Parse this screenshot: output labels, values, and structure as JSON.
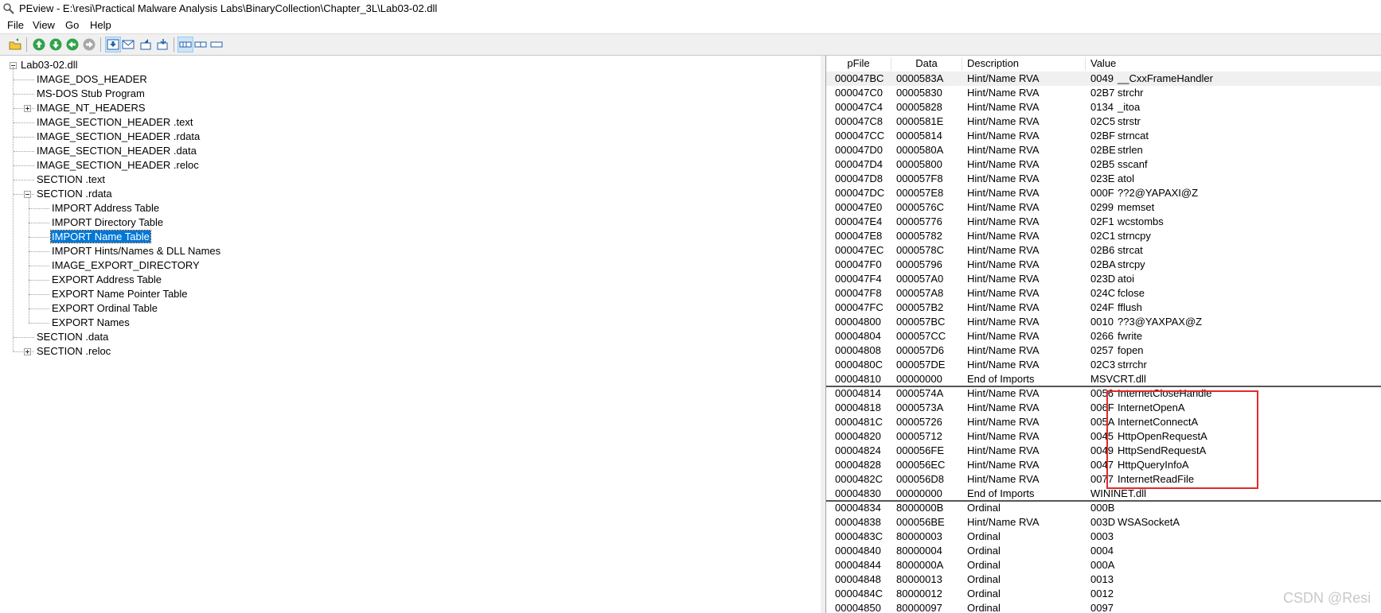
{
  "window": {
    "title": "PEview - E:\\resi\\Practical Malware Analysis Labs\\BinaryCollection\\Chapter_3L\\Lab03-02.dll",
    "icon": "peview-icon"
  },
  "menu": [
    {
      "label": "File"
    },
    {
      "label": "View"
    },
    {
      "label": "Go"
    },
    {
      "label": "Help"
    }
  ],
  "toolbar": [
    {
      "icon": "open-folder-icon"
    },
    {
      "icon": "up-arrow-icon"
    },
    {
      "icon": "down-arrow-icon"
    },
    {
      "icon": "back-arrow-icon"
    },
    {
      "icon": "forward-arrow-icon"
    },
    {
      "icon": "view-down-icon"
    },
    {
      "icon": "view-email-icon"
    },
    {
      "icon": "view-import-icon"
    },
    {
      "icon": "view-export-icon"
    },
    {
      "icon": "layout-1-icon"
    },
    {
      "icon": "layout-2-icon"
    },
    {
      "icon": "layout-3-icon"
    }
  ],
  "tree": {
    "root": "Lab03-02.dll",
    "items": [
      {
        "label": "IMAGE_DOS_HEADER",
        "level": 1
      },
      {
        "label": "MS-DOS Stub Program",
        "level": 1
      },
      {
        "label": "IMAGE_NT_HEADERS",
        "level": 1,
        "expander": "plus"
      },
      {
        "label": "IMAGE_SECTION_HEADER .text",
        "level": 1
      },
      {
        "label": "IMAGE_SECTION_HEADER .rdata",
        "level": 1
      },
      {
        "label": "IMAGE_SECTION_HEADER .data",
        "level": 1
      },
      {
        "label": "IMAGE_SECTION_HEADER .reloc",
        "level": 1
      },
      {
        "label": "SECTION .text",
        "level": 1
      },
      {
        "label": "SECTION .rdata",
        "level": 1,
        "expander": "minus"
      },
      {
        "label": "IMPORT Address Table",
        "level": 2
      },
      {
        "label": "IMPORT Directory Table",
        "level": 2
      },
      {
        "label": "IMPORT Name Table",
        "level": 2,
        "selected": true
      },
      {
        "label": "IMPORT Hints/Names & DLL Names",
        "level": 2
      },
      {
        "label": "IMAGE_EXPORT_DIRECTORY",
        "level": 2
      },
      {
        "label": "EXPORT Address Table",
        "level": 2
      },
      {
        "label": "EXPORT Name Pointer Table",
        "level": 2
      },
      {
        "label": "EXPORT Ordinal Table",
        "level": 2
      },
      {
        "label": "EXPORT Names",
        "level": 2
      },
      {
        "label": "SECTION .data",
        "level": 1
      },
      {
        "label": "SECTION .reloc",
        "level": 1,
        "expander": "plus"
      }
    ]
  },
  "table": {
    "columns": [
      "pFile",
      "Data",
      "Description",
      "Value"
    ],
    "rows": [
      {
        "pfile": "000047BC",
        "data": "0000583A",
        "desc": "Hint/Name RVA",
        "hint": "0049",
        "name": "__CxxFrameHandler"
      },
      {
        "pfile": "000047C0",
        "data": "00005830",
        "desc": "Hint/Name RVA",
        "hint": "02B7",
        "name": "strchr"
      },
      {
        "pfile": "000047C4",
        "data": "00005828",
        "desc": "Hint/Name RVA",
        "hint": "0134",
        "name": "_itoa"
      },
      {
        "pfile": "000047C8",
        "data": "0000581E",
        "desc": "Hint/Name RVA",
        "hint": "02C5",
        "name": "strstr"
      },
      {
        "pfile": "000047CC",
        "data": "00005814",
        "desc": "Hint/Name RVA",
        "hint": "02BF",
        "name": "strncat"
      },
      {
        "pfile": "000047D0",
        "data": "0000580A",
        "desc": "Hint/Name RVA",
        "hint": "02BE",
        "name": "strlen"
      },
      {
        "pfile": "000047D4",
        "data": "00005800",
        "desc": "Hint/Name RVA",
        "hint": "02B5",
        "name": "sscanf"
      },
      {
        "pfile": "000047D8",
        "data": "000057F8",
        "desc": "Hint/Name RVA",
        "hint": "023E",
        "name": "atol"
      },
      {
        "pfile": "000047DC",
        "data": "000057E8",
        "desc": "Hint/Name RVA",
        "hint": "000F",
        "name": "??2@YAPAXI@Z"
      },
      {
        "pfile": "000047E0",
        "data": "0000576C",
        "desc": "Hint/Name RVA",
        "hint": "0299",
        "name": "memset"
      },
      {
        "pfile": "000047E4",
        "data": "00005776",
        "desc": "Hint/Name RVA",
        "hint": "02F1",
        "name": "wcstombs"
      },
      {
        "pfile": "000047E8",
        "data": "00005782",
        "desc": "Hint/Name RVA",
        "hint": "02C1",
        "name": "strncpy"
      },
      {
        "pfile": "000047EC",
        "data": "0000578C",
        "desc": "Hint/Name RVA",
        "hint": "02B6",
        "name": "strcat"
      },
      {
        "pfile": "000047F0",
        "data": "00005796",
        "desc": "Hint/Name RVA",
        "hint": "02BA",
        "name": "strcpy"
      },
      {
        "pfile": "000047F4",
        "data": "000057A0",
        "desc": "Hint/Name RVA",
        "hint": "023D",
        "name": "atoi"
      },
      {
        "pfile": "000047F8",
        "data": "000057A8",
        "desc": "Hint/Name RVA",
        "hint": "024C",
        "name": "fclose"
      },
      {
        "pfile": "000047FC",
        "data": "000057B2",
        "desc": "Hint/Name RVA",
        "hint": "024F",
        "name": "fflush"
      },
      {
        "pfile": "00004800",
        "data": "000057BC",
        "desc": "Hint/Name RVA",
        "hint": "0010",
        "name": "??3@YAXPAX@Z"
      },
      {
        "pfile": "00004804",
        "data": "000057CC",
        "desc": "Hint/Name RVA",
        "hint": "0266",
        "name": "fwrite"
      },
      {
        "pfile": "00004808",
        "data": "000057D6",
        "desc": "Hint/Name RVA",
        "hint": "0257",
        "name": "fopen"
      },
      {
        "pfile": "0000480C",
        "data": "000057DE",
        "desc": "Hint/Name RVA",
        "hint": "02C3",
        "name": "strrchr"
      },
      {
        "pfile": "00004810",
        "data": "00000000",
        "desc": "End of Imports",
        "hint": "MSVCRT.dll",
        "name": "",
        "end": true
      },
      {
        "pfile": "00004814",
        "data": "0000574A",
        "desc": "Hint/Name RVA",
        "hint": "0056",
        "name": "InternetCloseHandle"
      },
      {
        "pfile": "00004818",
        "data": "0000573A",
        "desc": "Hint/Name RVA",
        "hint": "006F",
        "name": "InternetOpenA"
      },
      {
        "pfile": "0000481C",
        "data": "00005726",
        "desc": "Hint/Name RVA",
        "hint": "005A",
        "name": "InternetConnectA"
      },
      {
        "pfile": "00004820",
        "data": "00005712",
        "desc": "Hint/Name RVA",
        "hint": "0045",
        "name": "HttpOpenRequestA"
      },
      {
        "pfile": "00004824",
        "data": "000056FE",
        "desc": "Hint/Name RVA",
        "hint": "0049",
        "name": "HttpSendRequestA"
      },
      {
        "pfile": "00004828",
        "data": "000056EC",
        "desc": "Hint/Name RVA",
        "hint": "0047",
        "name": "HttpQueryInfoA"
      },
      {
        "pfile": "0000482C",
        "data": "000056D8",
        "desc": "Hint/Name RVA",
        "hint": "0077",
        "name": "InternetReadFile"
      },
      {
        "pfile": "00004830",
        "data": "00000000",
        "desc": "End of Imports",
        "hint": "WININET.dll",
        "name": "",
        "end": true
      },
      {
        "pfile": "00004834",
        "data": "8000000B",
        "desc": "Ordinal",
        "hint": "000B",
        "name": ""
      },
      {
        "pfile": "00004838",
        "data": "000056BE",
        "desc": "Hint/Name RVA",
        "hint": "003D",
        "name": "WSASocketA"
      },
      {
        "pfile": "0000483C",
        "data": "80000003",
        "desc": "Ordinal",
        "hint": "0003",
        "name": ""
      },
      {
        "pfile": "00004840",
        "data": "80000004",
        "desc": "Ordinal",
        "hint": "0004",
        "name": ""
      },
      {
        "pfile": "00004844",
        "data": "8000000A",
        "desc": "Ordinal",
        "hint": "000A",
        "name": ""
      },
      {
        "pfile": "00004848",
        "data": "80000013",
        "desc": "Ordinal",
        "hint": "0013",
        "name": ""
      },
      {
        "pfile": "0000484C",
        "data": "80000012",
        "desc": "Ordinal",
        "hint": "0012",
        "name": ""
      },
      {
        "pfile": "00004850",
        "data": "80000097",
        "desc": "Ordinal",
        "hint": "0097",
        "name": ""
      }
    ]
  },
  "annotation": {
    "color": "#e32a2a"
  },
  "watermark": "CSDN @Resi"
}
